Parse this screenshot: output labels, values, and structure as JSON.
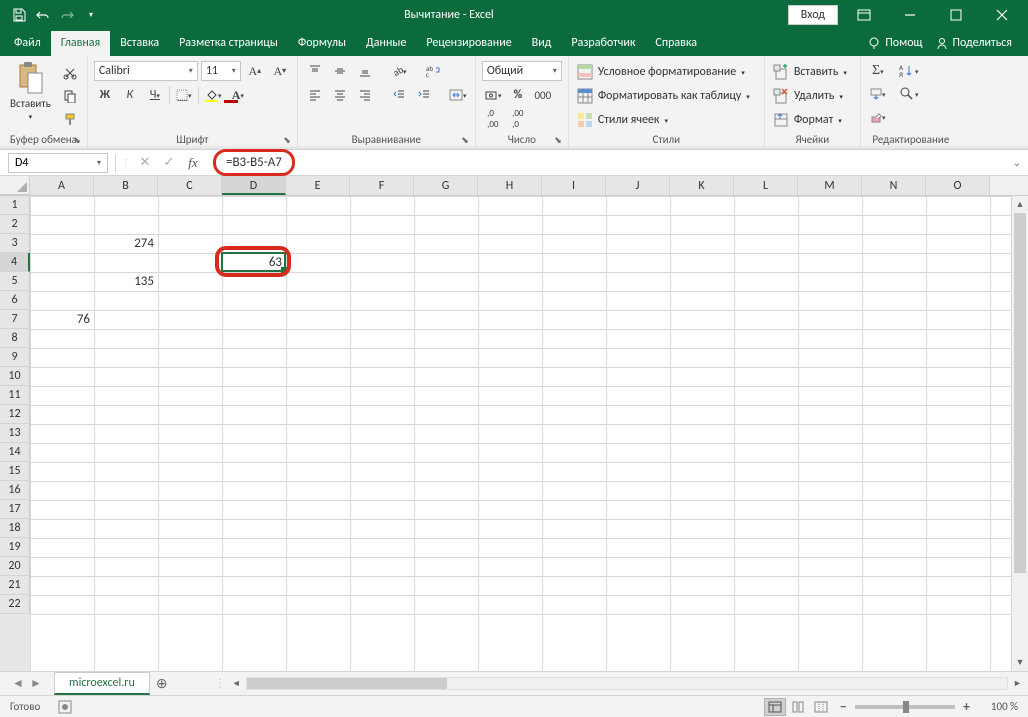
{
  "title": "Вычитание - Excel",
  "signin": "Вход",
  "tabs": {
    "file": "Файл",
    "home": "Главная",
    "insert": "Вставка",
    "layout": "Разметка страницы",
    "formulas": "Формулы",
    "data": "Данные",
    "review": "Рецензирование",
    "view": "Вид",
    "developer": "Разработчик",
    "help": "Справка",
    "tell": "Помощ",
    "share": "Поделиться"
  },
  "ribbon": {
    "paste": "Вставить",
    "clipboard": "Буфер обмена",
    "font_name": "Calibri",
    "font_size": "11",
    "font": "Шрифт",
    "bold": "Ж",
    "italic": "К",
    "underline": "Ч",
    "alignment": "Выравнивание",
    "number_format": "Общий",
    "number": "Число",
    "cond_fmt": "Условное форматирование",
    "fmt_table": "Форматировать как таблицу",
    "cell_styles": "Стили ячеек",
    "styles": "Стили",
    "insert_cells": "Вставить",
    "delete_cells": "Удалить",
    "format_cells": "Формат",
    "cells": "Ячейки",
    "editing": "Редактирование"
  },
  "namebox": "D4",
  "formula": "=B3-B5-A7",
  "columns": [
    "A",
    "B",
    "C",
    "D",
    "E",
    "F",
    "G",
    "H",
    "I",
    "J",
    "K",
    "L",
    "M",
    "N",
    "O"
  ],
  "rows": [
    "1",
    "2",
    "3",
    "4",
    "5",
    "6",
    "7",
    "8",
    "9",
    "10",
    "11",
    "12",
    "13",
    "14",
    "15",
    "16",
    "17",
    "18",
    "19",
    "20",
    "21",
    "22"
  ],
  "cell_data": {
    "B3": "274",
    "B5": "135",
    "A7": "76",
    "D4": "63"
  },
  "selected_col": "D",
  "selected_row": "4",
  "sheet_tab": "microexcel.ru",
  "status": "Готово",
  "zoom": "100 %"
}
